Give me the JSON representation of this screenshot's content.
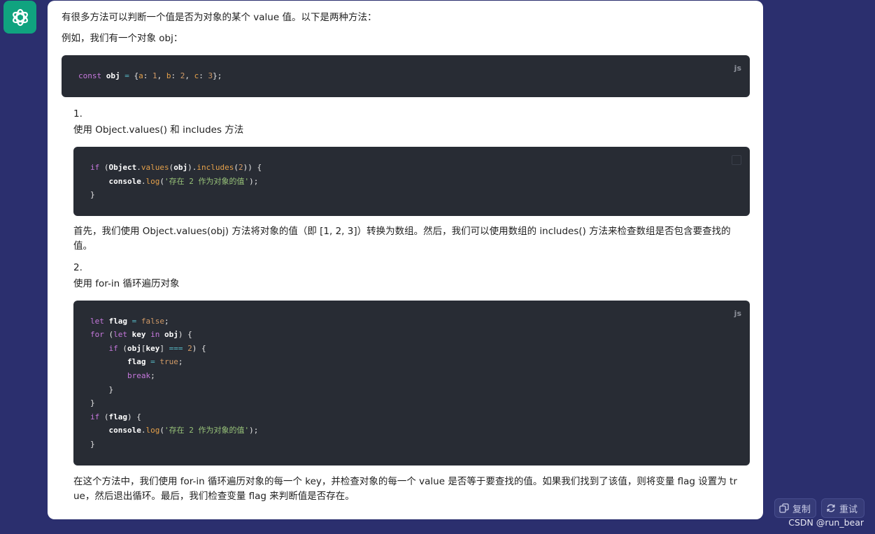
{
  "intro": "有很多方法可以判断一个值是否为对象的某个 value 值。以下是两种方法：",
  "example": "例如，我们有一个对象 obj：",
  "code_lang": "js",
  "step1": {
    "num": "1.",
    "title": "使用 Object.values() 和 includes 方法",
    "desc_line1": "首先，我们使用 Object.values(obj) 方法将对象的值（即 [1, 2, 3]）转换为数组。然后，我们可以使用数组的 includes() 方法来检查数组是否包含要查找的",
    "desc_line2": "值。"
  },
  "step2": {
    "num": "2.",
    "title": "使用 for-in 循环遍历对象",
    "desc_line1": "在这个方法中，我们使用 for-in 循环遍历对象的每一个 key，并检查对象的每一个 value 是否等于要查找的值。如果我们找到了该值，则将变量 flag 设置为 tr",
    "desc_line2": "ue，然后退出循环。最后，我们检查变量 flag 来判断值是否存在。"
  },
  "code_string": "'存在 2 作为对象的值'",
  "buttons": {
    "copy": "复制",
    "retry": "重试"
  },
  "watermark": "CSDN @run_bear",
  "colors": {
    "background": "#2b2f6e",
    "code_bg": "#282c34",
    "brand": "#10a37f"
  }
}
